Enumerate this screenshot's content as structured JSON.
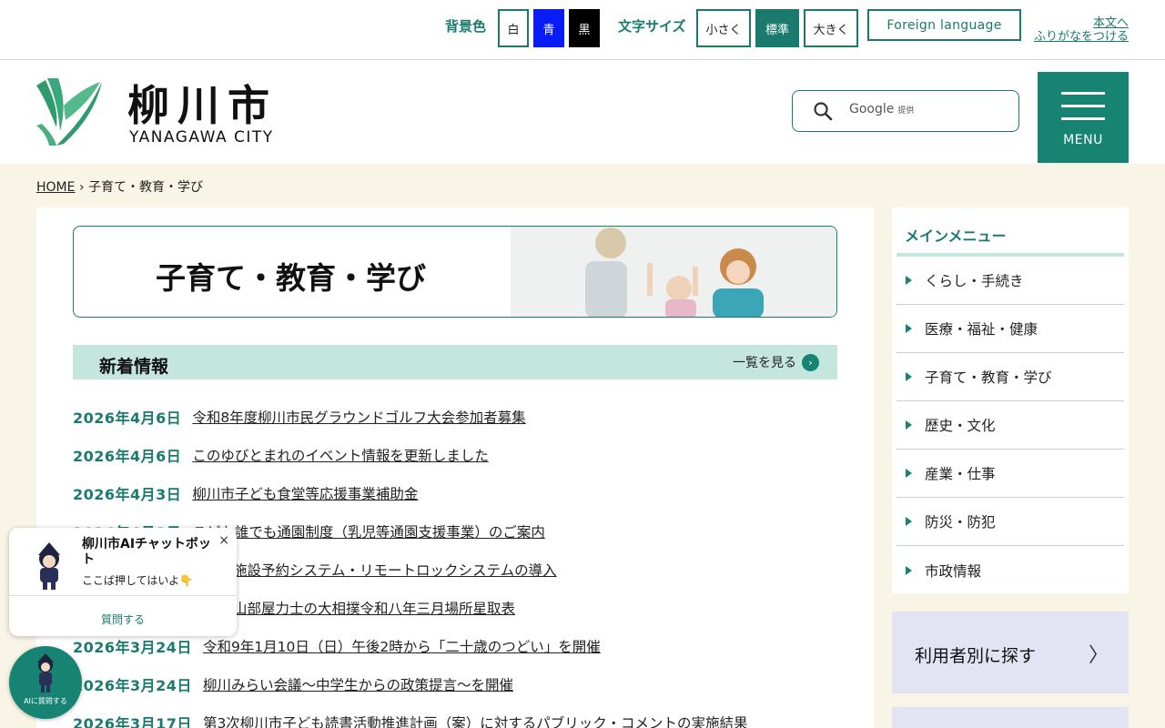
{
  "utility": {
    "bg_label": "背景色",
    "bg_white": "白",
    "bg_blue": "青",
    "bg_black": "黒",
    "size_label": "文字サイズ",
    "size_small": "小さく",
    "size_normal": "標準",
    "size_large": "大きく",
    "foreign": "Foreign language",
    "skip_main": "本文へ",
    "furigana": "ふりがなをつける"
  },
  "header": {
    "logo_jp": "柳川市",
    "logo_en": "YANAGAWA CITY",
    "search_brand": "Google",
    "search_provided": "提供",
    "menu_label": "MENU"
  },
  "breadcrumb": {
    "home": "HOME",
    "separator": "›",
    "current": "子育て・教育・学び"
  },
  "hero": {
    "title": "子育て・教育・学び"
  },
  "news": {
    "title": "新着情報",
    "more": "一覧を見る",
    "items": [
      {
        "date": "2026年4月6日",
        "title": "令和8年度柳川市民グラウンドゴルフ大会参加者募集"
      },
      {
        "date": "2026年4月6日",
        "title": "このゆびとまれのイベント情報を更新しました"
      },
      {
        "date": "2026年4月3日",
        "title": "柳川市子ども食堂等応援事業補助金"
      },
      {
        "date": "2026年4月1日",
        "title": "こども誰でも通園制度（乳児等通園支援事業）のご案内"
      },
      {
        "date": "",
        "title": "施設予約システム・リモートロックシステムの導入"
      },
      {
        "date": "",
        "title": "山部屋力士の大相撲令和八年三月場所星取表"
      },
      {
        "date": "2026年3月24日",
        "title": "令和9年1月10日（日）午後2時から「二十歳のつどい」を開催"
      },
      {
        "date": "2026年3月24日",
        "title": "柳川みらい会議～中学生からの政策提言～を開催"
      },
      {
        "date": "2026年3月17日",
        "title": "第3次柳川市子ども読書活動推進計画（案）に対するパブリック・コメントの実施結果"
      }
    ]
  },
  "sidebar": {
    "title": "メインメニュー",
    "items": [
      {
        "label": "くらし・手続き"
      },
      {
        "label": "医療・福祉・健康"
      },
      {
        "label": "子育て・教育・学び"
      },
      {
        "label": "歴史・文化"
      },
      {
        "label": "産業・仕事"
      },
      {
        "label": "防災・防犯"
      },
      {
        "label": "市政情報"
      }
    ],
    "user_search": "利用者別に探す",
    "user_chevron": "〉"
  },
  "chat": {
    "title": "柳川市AIチャットボット",
    "subtitle": "ここば押してはいよ👇",
    "close": "×",
    "ask": "質問する",
    "fab_label": "AIに質問する"
  },
  "colors": {
    "brand": "#1a7a6e",
    "menu_bg": "#168373",
    "band_bg": "#f8f5e6",
    "news_head_bg": "#c5e6dd",
    "user_box_bg": "#e2e4f3"
  }
}
